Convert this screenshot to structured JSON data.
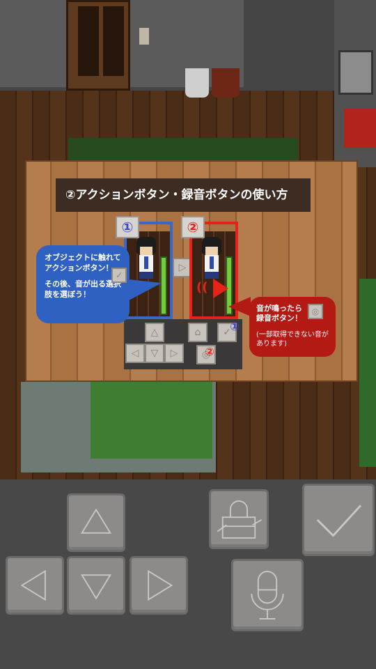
{
  "tutorial": {
    "title": "②アクションボタン・録音ボタンの使い方",
    "step1_marker": "①",
    "step2_marker": "②",
    "action_bubble": {
      "line1": "オブジェクトに触れて",
      "line2": "アクションボタン！",
      "line3": "その後、音が出る選択",
      "line4": "肢を選ぼう！"
    },
    "record_bubble": {
      "line1": "音が鳴ったら",
      "line2": "録音ボタン！",
      "note1": "(一部取得できない音が",
      "note2": "あります)"
    },
    "mini_pad_marker1": "①",
    "mini_pad_marker2": "②"
  },
  "colors": {
    "step1": "#3b67c5",
    "step2": "#e5231b",
    "bubble_blue": "#2f61c2",
    "bubble_red": "#b41a14",
    "button_gray": "#8c8b8a"
  },
  "controls": {
    "dpad": [
      "up-arrow-icon",
      "left-arrow-icon",
      "down-arrow-icon",
      "right-arrow-icon"
    ],
    "bag_button_icon": "bag-icon",
    "record_button_icon": "microphone-icon",
    "action_button_icon": "check-icon"
  }
}
